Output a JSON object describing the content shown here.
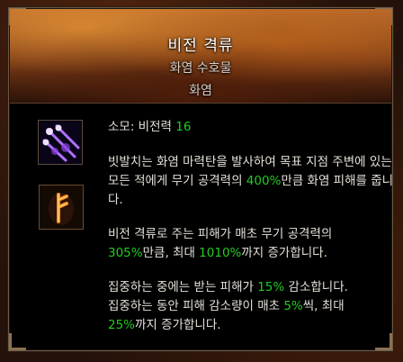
{
  "tooltip": {
    "title": "비전 격류",
    "rune_name": "화염 수호물",
    "element": "화염",
    "icons": {
      "skill": "arcane-torrent-icon",
      "rune": "rune-icon"
    },
    "cost": {
      "label": "소모: 비전력 ",
      "value": "16"
    },
    "para1": {
      "before": "빗발치는 화염 마력탄을 발사하여 목표 지점 주변에 있는 모든 적에게 무기 공격력의 ",
      "pct": "400%",
      "after": "만큼 화염 피해를 줍니다."
    },
    "para2": {
      "line1": "비전 격류로 주는 피해가 매초 무기 공격력의",
      "pct1": "305%",
      "mid": "만큼, 최대 ",
      "pct2": "1010%",
      "after": "까지 증가합니다."
    },
    "para3": {
      "before1": "집중하는 중에는 받는 피해가 ",
      "pct1": "15%",
      "after1": " 감소합니다.",
      "before2": "집중하는 동안 피해 감소량이 매초 ",
      "pct2": "5%",
      "after2": "씩, 최대",
      "pct3": "25%",
      "after3": "까지 증가합니다."
    },
    "colors": {
      "highlight": "#22cc22",
      "text": "#e6e0d8",
      "header": "#b8692a"
    }
  }
}
